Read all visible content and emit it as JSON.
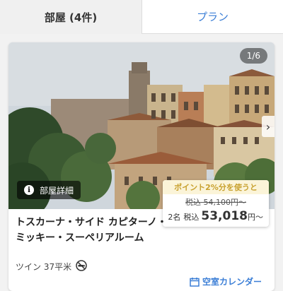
{
  "tabs": {
    "rooms_label": "部屋 (4件)",
    "plans_label": "プラン"
  },
  "room": {
    "image_counter": "1/6",
    "detail_button_label": "部屋詳細",
    "name": "トスカーナ・サイド カピターノ・ミッキー・スーペリアルーム",
    "room_type": "ツイン",
    "size": "37平米",
    "calendar_link_label": "空室カレンダー"
  },
  "price": {
    "points_banner": "ポイント2%分を使うと",
    "old_price_prefix": "税込",
    "old_price": "54,100円〜",
    "guests": "2名",
    "tax_label": "税込",
    "amount": "53,018",
    "suffix": "円〜"
  },
  "colors": {
    "accent_blue": "#3b7ed6",
    "points_gold": "#c8a12f"
  }
}
